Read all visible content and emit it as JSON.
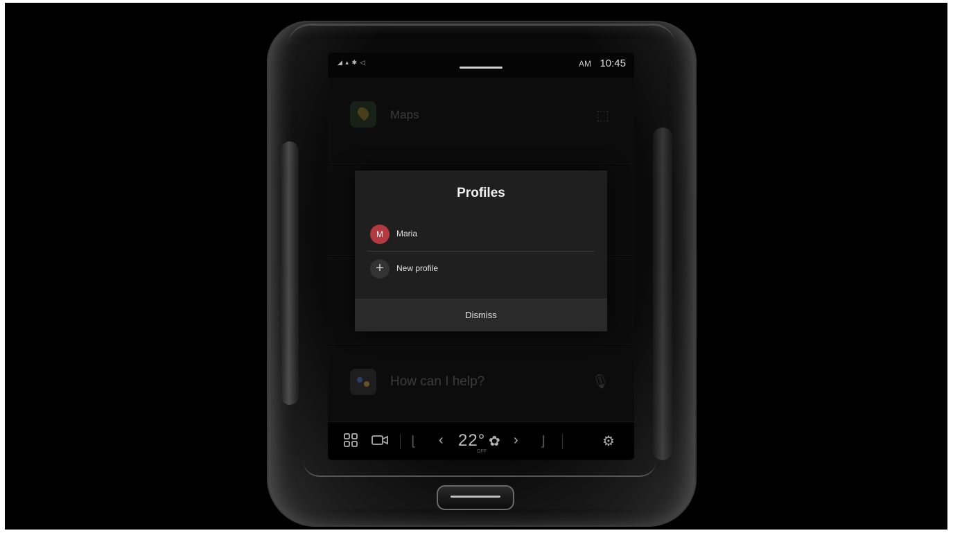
{
  "status_bar": {
    "icons": "◢ ▴ ✱ ◁",
    "am_label": "AM",
    "time": "10:45"
  },
  "home": {
    "maps_label": "Maps",
    "assistant_prompt": "How can I help?"
  },
  "dialog": {
    "title": "Profiles",
    "profiles": [
      {
        "initial": "M",
        "name": "Maria",
        "avatar_color": "#b33a3e"
      }
    ],
    "new_profile_label": "New profile",
    "dismiss_label": "Dismiss"
  },
  "dock": {
    "temperature": "22°",
    "temperature_sub": "OFF"
  }
}
